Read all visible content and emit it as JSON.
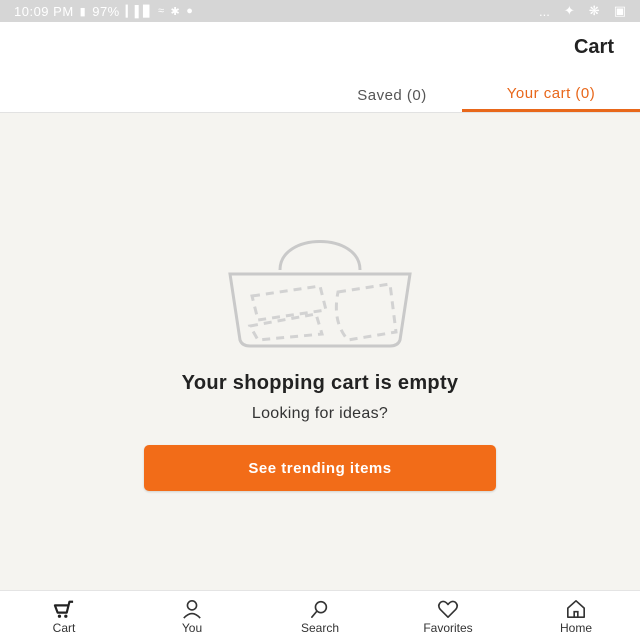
{
  "status_bar": {
    "time": "10:09 PM",
    "battery": "97%",
    "right_dots": "..."
  },
  "header": {
    "title": "Cart",
    "tabs": [
      {
        "label": "Your cart (0)",
        "active": true
      },
      {
        "label": "Saved (0)",
        "active": false
      }
    ]
  },
  "empty_state": {
    "title": "Your shopping cart is empty",
    "subtitle": "Looking for ideas?",
    "button_label": "See trending items"
  },
  "bottom_nav": [
    {
      "label": "Home",
      "icon": "home-icon"
    },
    {
      "label": "Favorites",
      "icon": "heart-icon"
    },
    {
      "label": "Search",
      "icon": "search-icon"
    },
    {
      "label": "You",
      "icon": "person-icon"
    },
    {
      "label": "Cart",
      "icon": "cart-icon"
    }
  ],
  "colors": {
    "accent": "#f26c18",
    "tab_active": "#e8671a",
    "background": "#f5f4f0"
  }
}
